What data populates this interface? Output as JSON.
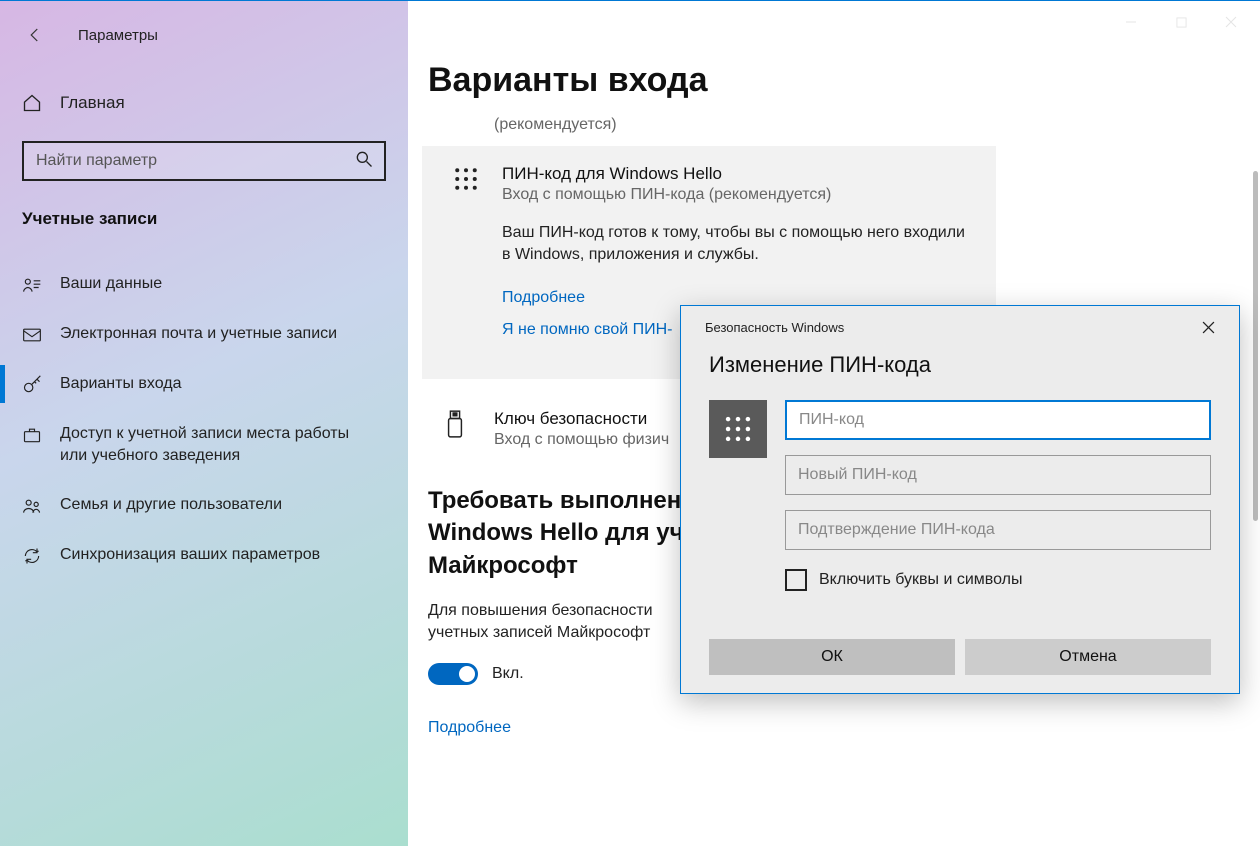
{
  "window": {
    "title": "Параметры"
  },
  "sidebar": {
    "home": "Главная",
    "search_placeholder": "Найти параметр",
    "section": "Учетные записи",
    "items": [
      {
        "label": "Ваши данные"
      },
      {
        "label": "Электронная почта и учетные записи"
      },
      {
        "label": "Варианты входа"
      },
      {
        "label": "Доступ к учетной записи места работы или учебного заведения"
      },
      {
        "label": "Семья и другие пользователи"
      },
      {
        "label": "Синхронизация ваших параметров"
      }
    ],
    "selected_index": 2
  },
  "main": {
    "title": "Варианты входа",
    "recommended": "(рекомендуется)",
    "pin_card": {
      "title": "ПИН-код для Windows Hello",
      "subtitle": "Вход с помощью ПИН-кода (рекомендуется)",
      "description": "Ваш ПИН-код готов к тому, чтобы вы с помощью него входили в Windows, приложения и службы.",
      "more_link": "Подробнее",
      "forgot_link": "Я не помню свой ПИН-"
    },
    "security_key": {
      "title": "Ключ безопасности",
      "subtitle": "Вход с помощью физич"
    },
    "hello_section": {
      "title": "Требовать выполнени\nWindows Hello для уч\nМайкрософт",
      "desc": "Для повышения безопасности\nучетных записей Майкрософт",
      "toggle_on": true,
      "toggle_label": "Вкл.",
      "more": "Подробнее"
    }
  },
  "dialog": {
    "titlebar": "Безопасность Windows",
    "heading": "Изменение ПИН-кода",
    "pin_placeholder": "ПИН-код",
    "new_pin_placeholder": "Новый ПИН-код",
    "confirm_pin_placeholder": "Подтверждение ПИН-кода",
    "checkbox_label": "Включить буквы и символы",
    "ok": "ОК",
    "cancel": "Отмена"
  }
}
